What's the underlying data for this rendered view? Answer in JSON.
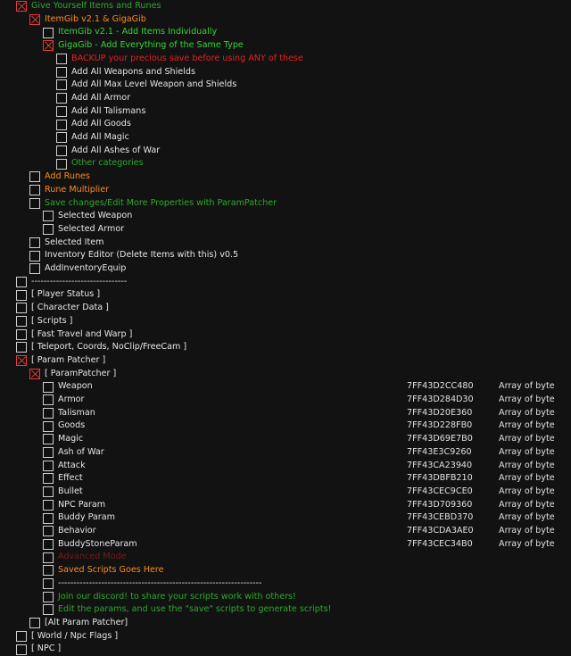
{
  "colors": {
    "white": "#e6e6e6",
    "green": "#2ea82e",
    "bright_green": "#38d438",
    "orange": "#ff8c1a",
    "red": "#e52020",
    "dark_red": "#7a1a1a"
  },
  "rows": [
    {
      "label": "Give Yourself Items and Runes",
      "level": 0,
      "checked": true,
      "color": "green"
    },
    {
      "label": "ItemGib v2.1 & GigaGib",
      "level": 1,
      "checked": true,
      "color": "orange"
    },
    {
      "label": "ItemGib v2.1 - Add Items Individually",
      "level": 2,
      "checked": false,
      "color": "bright_green"
    },
    {
      "label": "GigaGib - Add Everything of the Same Type",
      "level": 2,
      "checked": true,
      "color": "bright_green"
    },
    {
      "label": "BACKUP your precious save before using ANY of these",
      "level": 3,
      "checked": false,
      "color": "red"
    },
    {
      "label": "Add All Weapons and Shields",
      "level": 3,
      "checked": false,
      "color": "white"
    },
    {
      "label": "Add All Max Level Weapon and Shields",
      "level": 3,
      "checked": false,
      "color": "white"
    },
    {
      "label": "Add All Armor",
      "level": 3,
      "checked": false,
      "color": "white"
    },
    {
      "label": "Add All Talismans",
      "level": 3,
      "checked": false,
      "color": "white"
    },
    {
      "label": "Add All Goods",
      "level": 3,
      "checked": false,
      "color": "white"
    },
    {
      "label": "Add All Magic",
      "level": 3,
      "checked": false,
      "color": "white"
    },
    {
      "label": "Add All Ashes of War",
      "level": 3,
      "checked": false,
      "color": "white"
    },
    {
      "label": "Other categories",
      "level": 3,
      "checked": false,
      "color": "green"
    },
    {
      "label": "Add Runes",
      "level": 1,
      "checked": false,
      "color": "orange"
    },
    {
      "label": "Rune Multiplier",
      "level": 1,
      "checked": false,
      "color": "orange"
    },
    {
      "label": "Save changes/Edit More Properties with ParamPatcher",
      "level": 1,
      "checked": false,
      "color": "green"
    },
    {
      "label": "Selected Weapon",
      "level": 2,
      "checked": false,
      "color": "white"
    },
    {
      "label": "Selected Armor",
      "level": 2,
      "checked": false,
      "color": "white"
    },
    {
      "label": "Selected Item",
      "level": 1,
      "checked": false,
      "color": "white"
    },
    {
      "label": "Inventory Editor (Delete Items with this) v0.5",
      "level": 1,
      "checked": false,
      "color": "white"
    },
    {
      "label": "AddInventoryEquip",
      "level": 1,
      "checked": false,
      "color": "white"
    },
    {
      "label": "-------------------------------",
      "level": 0,
      "checked": false,
      "color": "white"
    },
    {
      "label": "[ Player Status ]",
      "level": 0,
      "checked": false,
      "color": "white"
    },
    {
      "label": "[ Character Data ]",
      "level": 0,
      "checked": false,
      "color": "white"
    },
    {
      "label": "[ Scripts ]",
      "level": 0,
      "checked": false,
      "color": "white"
    },
    {
      "label": "[ Fast Travel and Warp ]",
      "level": 0,
      "checked": false,
      "color": "white"
    },
    {
      "label": "[ Teleport, Coords, NoClip/FreeCam ]",
      "level": 0,
      "checked": false,
      "color": "white"
    },
    {
      "label": "[ Param Patcher ]",
      "level": 0,
      "checked": true,
      "color": "white"
    },
    {
      "label": "[ ParamPatcher ]",
      "level": 1,
      "checked": true,
      "color": "white"
    },
    {
      "label": "Weapon",
      "level": 2,
      "checked": false,
      "color": "white",
      "address": "7FF43D2CC480",
      "type": "Array of byte"
    },
    {
      "label": "Armor",
      "level": 2,
      "checked": false,
      "color": "white",
      "address": "7FF43D284D30",
      "type": "Array of byte"
    },
    {
      "label": "Talisman",
      "level": 2,
      "checked": false,
      "color": "white",
      "address": "7FF43D20E360",
      "type": "Array of byte"
    },
    {
      "label": "Goods",
      "level": 2,
      "checked": false,
      "color": "white",
      "address": "7FF43D228FB0",
      "type": "Array of byte"
    },
    {
      "label": "Magic",
      "level": 2,
      "checked": false,
      "color": "white",
      "address": "7FF43D69E7B0",
      "type": "Array of byte"
    },
    {
      "label": "Ash of War",
      "level": 2,
      "checked": false,
      "color": "white",
      "address": "7FF43E3C9260",
      "type": "Array of byte"
    },
    {
      "label": "Attack",
      "level": 2,
      "checked": false,
      "color": "white",
      "address": "7FF43CA23940",
      "type": "Array of byte"
    },
    {
      "label": "Effect",
      "level": 2,
      "checked": false,
      "color": "white",
      "address": "7FF43DBFB210",
      "type": "Array of byte"
    },
    {
      "label": "Bullet",
      "level": 2,
      "checked": false,
      "color": "white",
      "address": "7FF43CEC9CE0",
      "type": "Array of byte"
    },
    {
      "label": "NPC Param",
      "level": 2,
      "checked": false,
      "color": "white",
      "address": "7FF43D709360",
      "type": "Array of byte"
    },
    {
      "label": "Buddy Param",
      "level": 2,
      "checked": false,
      "color": "white",
      "address": "7FF43CEBD370",
      "type": "Array of byte"
    },
    {
      "label": "Behavior",
      "level": 2,
      "checked": false,
      "color": "white",
      "address": "7FF43CDA3AE0",
      "type": "Array of byte"
    },
    {
      "label": "BuddyStoneParam",
      "level": 2,
      "checked": false,
      "color": "white",
      "address": "7FF43CEC34B0",
      "type": "Array of byte"
    },
    {
      "label": "Advanced Mode",
      "level": 2,
      "checked": false,
      "color": "dark_red"
    },
    {
      "label": "Saved Scripts Goes Here",
      "level": 2,
      "checked": false,
      "color": "orange"
    },
    {
      "label": "------------------------------------------------------------------",
      "level": 2,
      "checked": false,
      "color": "white"
    },
    {
      "label": "Join our discord! to share your scripts work with others!",
      "level": 2,
      "checked": false,
      "color": "green"
    },
    {
      "label": "Edit the params, and use the \"save\" scripts to generate scripts!",
      "level": 2,
      "checked": false,
      "color": "green"
    },
    {
      "label": "[Alt Param Patcher]",
      "level": 1,
      "checked": false,
      "color": "white"
    },
    {
      "label": "[ World / Npc Flags ]",
      "level": 0,
      "checked": false,
      "color": "white"
    },
    {
      "label": "[ NPC ]",
      "level": 0,
      "checked": false,
      "color": "white"
    }
  ]
}
